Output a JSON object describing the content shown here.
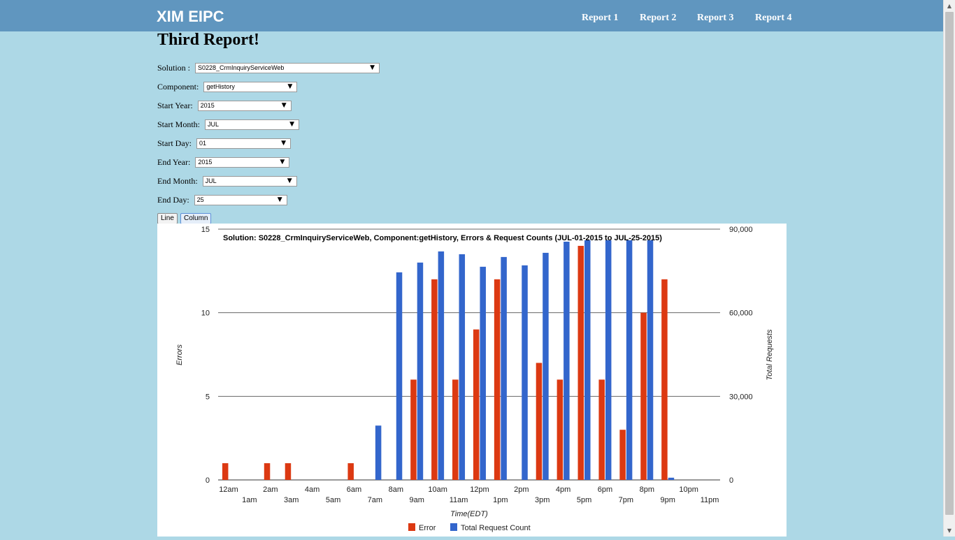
{
  "nav": {
    "brand": "XIM EIPC",
    "links": [
      "Report 1",
      "Report 2",
      "Report 3",
      "Report 4"
    ]
  },
  "page_title": "Third Report!",
  "form": {
    "solution": {
      "label": "Solution :",
      "value": "S0228_CrmInquiryServiceWeb"
    },
    "component": {
      "label": "Component:",
      "value": "getHistory"
    },
    "start_year": {
      "label": "Start Year:",
      "value": "2015"
    },
    "start_month": {
      "label": "Start Month:",
      "value": "JUL"
    },
    "start_day": {
      "label": "Start Day:",
      "value": "01"
    },
    "end_year": {
      "label": "End Year:",
      "value": "2015"
    },
    "end_month": {
      "label": "End Month:",
      "value": "JUL"
    },
    "end_day": {
      "label": "End Day:",
      "value": "25"
    }
  },
  "buttons": {
    "line": "Line",
    "column": "Column",
    "active": "Column"
  },
  "colors": {
    "navbar": "#6096bf",
    "background": "#add8e6",
    "error": "#dc3912",
    "total": "#3366cc"
  },
  "chart_data": {
    "type": "bar",
    "title": "Solution: S0228_CrmInquiryServiceWeb, Component:getHistory, Errors & Request Counts (JUL-01-2015 to JUL-25-2015)",
    "xlabel": "Time(EDT)",
    "ylabel": "Errors",
    "ylabel_right": "Total Requests",
    "categories": [
      "12am",
      "1am",
      "2am",
      "3am",
      "4am",
      "5am",
      "6am",
      "7am",
      "8am",
      "9am",
      "10am",
      "11am",
      "12pm",
      "1pm",
      "2pm",
      "3pm",
      "4pm",
      "5pm",
      "6pm",
      "7pm",
      "8pm",
      "9pm",
      "10pm",
      "11pm"
    ],
    "series": [
      {
        "name": "Error",
        "axis": "left",
        "values": [
          1,
          0,
          1,
          1,
          0,
          0,
          1,
          0,
          0,
          6,
          12,
          6,
          9,
          12,
          0,
          7,
          6,
          14,
          6,
          3,
          10,
          12,
          0,
          0
        ]
      },
      {
        "name": "Total Request Count",
        "axis": "right",
        "values": [
          0,
          0,
          0,
          0,
          0,
          0,
          0,
          19500,
          74500,
          78000,
          82000,
          81000,
          76500,
          80000,
          77000,
          81500,
          85500,
          86000,
          86000,
          86000,
          86000,
          800,
          0,
          0
        ]
      }
    ],
    "ylim": [
      0,
      15
    ],
    "ylim_right": [
      0,
      90000
    ],
    "yticks": [
      "0",
      "5",
      "10",
      "15"
    ],
    "yticks_right": [
      "0",
      "30,000",
      "60,000",
      "90,000"
    ],
    "legend": "bottom",
    "grid": true
  }
}
